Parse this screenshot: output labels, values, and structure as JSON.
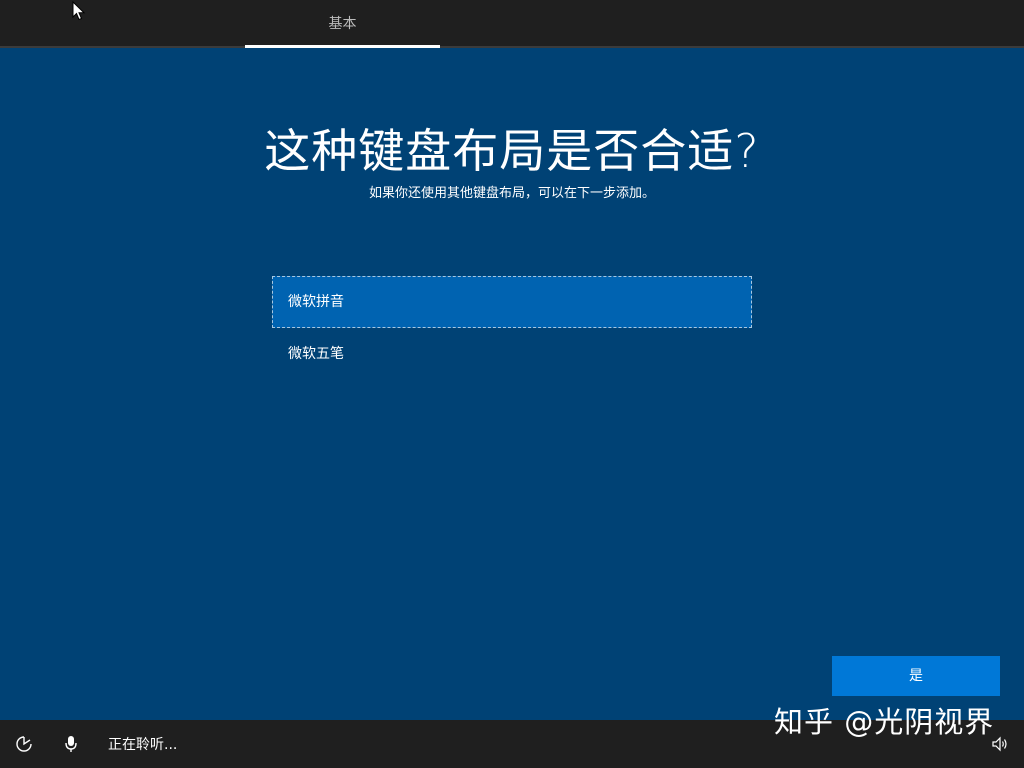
{
  "header": {
    "step_label": "基本"
  },
  "main": {
    "title": "这种键盘布局是否合适?",
    "subtitle": "如果你还使用其他键盘布局，可以在下一步添加。",
    "layouts": [
      {
        "label": "微软拼音",
        "selected": true
      },
      {
        "label": "微软五笔",
        "selected": false
      }
    ],
    "yes_button_label": "是"
  },
  "footer": {
    "listening_text": "正在聆听...",
    "icons": [
      "ease-of-access-icon",
      "microphone-icon",
      "volume-icon"
    ]
  },
  "overlay": {
    "watermark": "知乎 @光阴视界"
  },
  "colors": {
    "background": "#004275",
    "selected_item": "#0063b1",
    "button": "#0078d7",
    "bars": "#1f1f1f"
  }
}
